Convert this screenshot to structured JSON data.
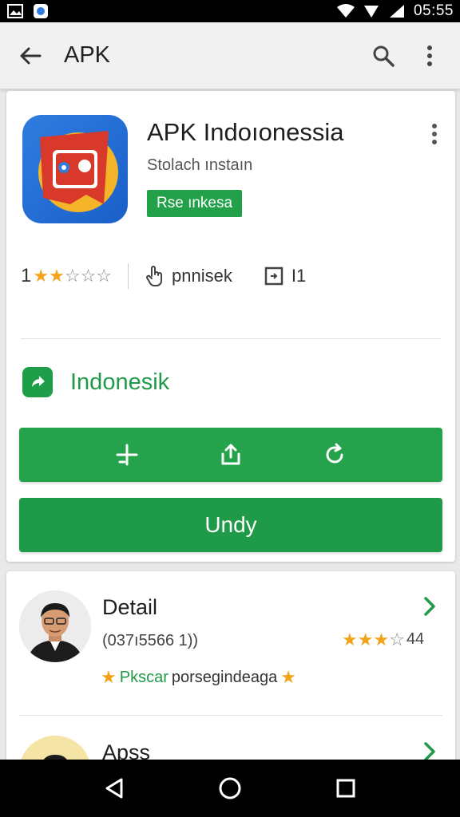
{
  "status_bar": {
    "time": "05:55",
    "left_icons": [
      "gallery-icon",
      "app-notification-icon"
    ],
    "right_icons": [
      "wifi-icon",
      "signal-icon",
      "cell-signal-icon"
    ]
  },
  "app_bar": {
    "title": "APK",
    "back_icon": "back-arrow-icon",
    "search_icon": "search-icon",
    "menu_icon": "more-vertical-icon"
  },
  "app": {
    "name": "APK Indoıonessia",
    "developer": "Stolach ınstaın",
    "badge": "Rse ınkesa",
    "rating": "1",
    "stars": {
      "filled": 2,
      "total": 5
    },
    "installs_label": "pnnisek",
    "size_label": "I1",
    "category": "Indonesik",
    "action_icons": [
      "add-icon",
      "share-icon",
      "refresh-icon"
    ],
    "primary_button": "Undy",
    "colors": {
      "accent": "#1f9a48",
      "star": "#f2a317",
      "icon_bg": "#2f7de0"
    }
  },
  "reviews": {
    "items": [
      {
        "title": "Detail",
        "subtitle": "(037ı5566 1))",
        "rating": "44",
        "stars_filled": 3,
        "stars_total": 4,
        "tag_green": "Pkscar",
        "tag_text": "porsegindeaga"
      },
      {
        "title": "Apss"
      }
    ]
  },
  "nav_bar": {
    "icons": [
      "back-triangle-icon",
      "home-circle-icon",
      "recents-square-icon"
    ]
  }
}
